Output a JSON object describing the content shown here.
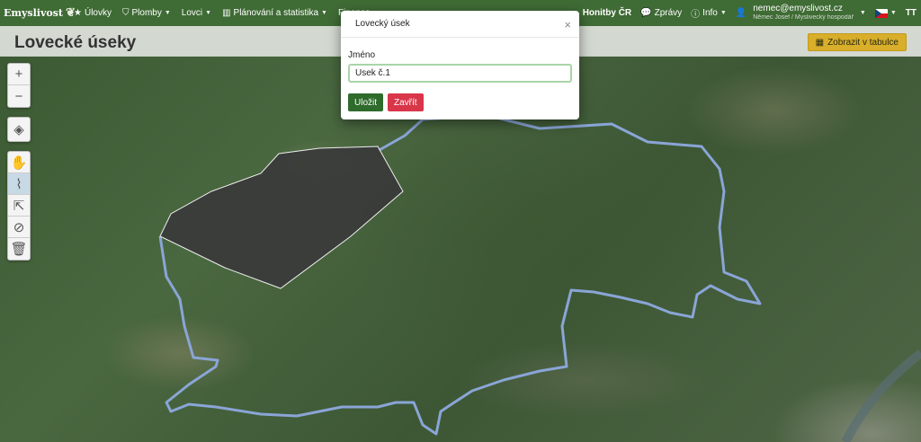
{
  "brand": {
    "name": "Emyslivost"
  },
  "nav": {
    "items": [
      {
        "label": "Úlovky",
        "icon": "star-icon",
        "caret": false
      },
      {
        "label": "Plomby",
        "icon": "tag-icon",
        "caret": true
      },
      {
        "label": "Lovci",
        "icon": "",
        "caret": true
      },
      {
        "label": "Plánování a statistika",
        "icon": "chart-icon",
        "caret": true
      },
      {
        "label": "Finance",
        "icon": "",
        "caret": true
      }
    ],
    "right": {
      "honitby": "Honitby ČR",
      "messages": "Zprávy",
      "info": "Info",
      "user_email": "nemec@emyslivost.cz",
      "user_sub": "Němec Josef / Myslivecký hospodář",
      "lang_toggle": "TT"
    }
  },
  "page": {
    "title": "Lovecké úseky",
    "table_button": "Zobrazit v tabulce"
  },
  "modal": {
    "title": "Lovecký úsek",
    "field_label": "Jméno",
    "field_value": "Úsek č.1",
    "save_label": "Uložit",
    "close_label": "Zavřít"
  },
  "map": {
    "toolbar_zoom": [
      {
        "label": "+"
      },
      {
        "label": "−"
      }
    ],
    "colors": {
      "polygon_fill": "#3a3a3a",
      "route_stroke": "#8aa5d6"
    }
  }
}
